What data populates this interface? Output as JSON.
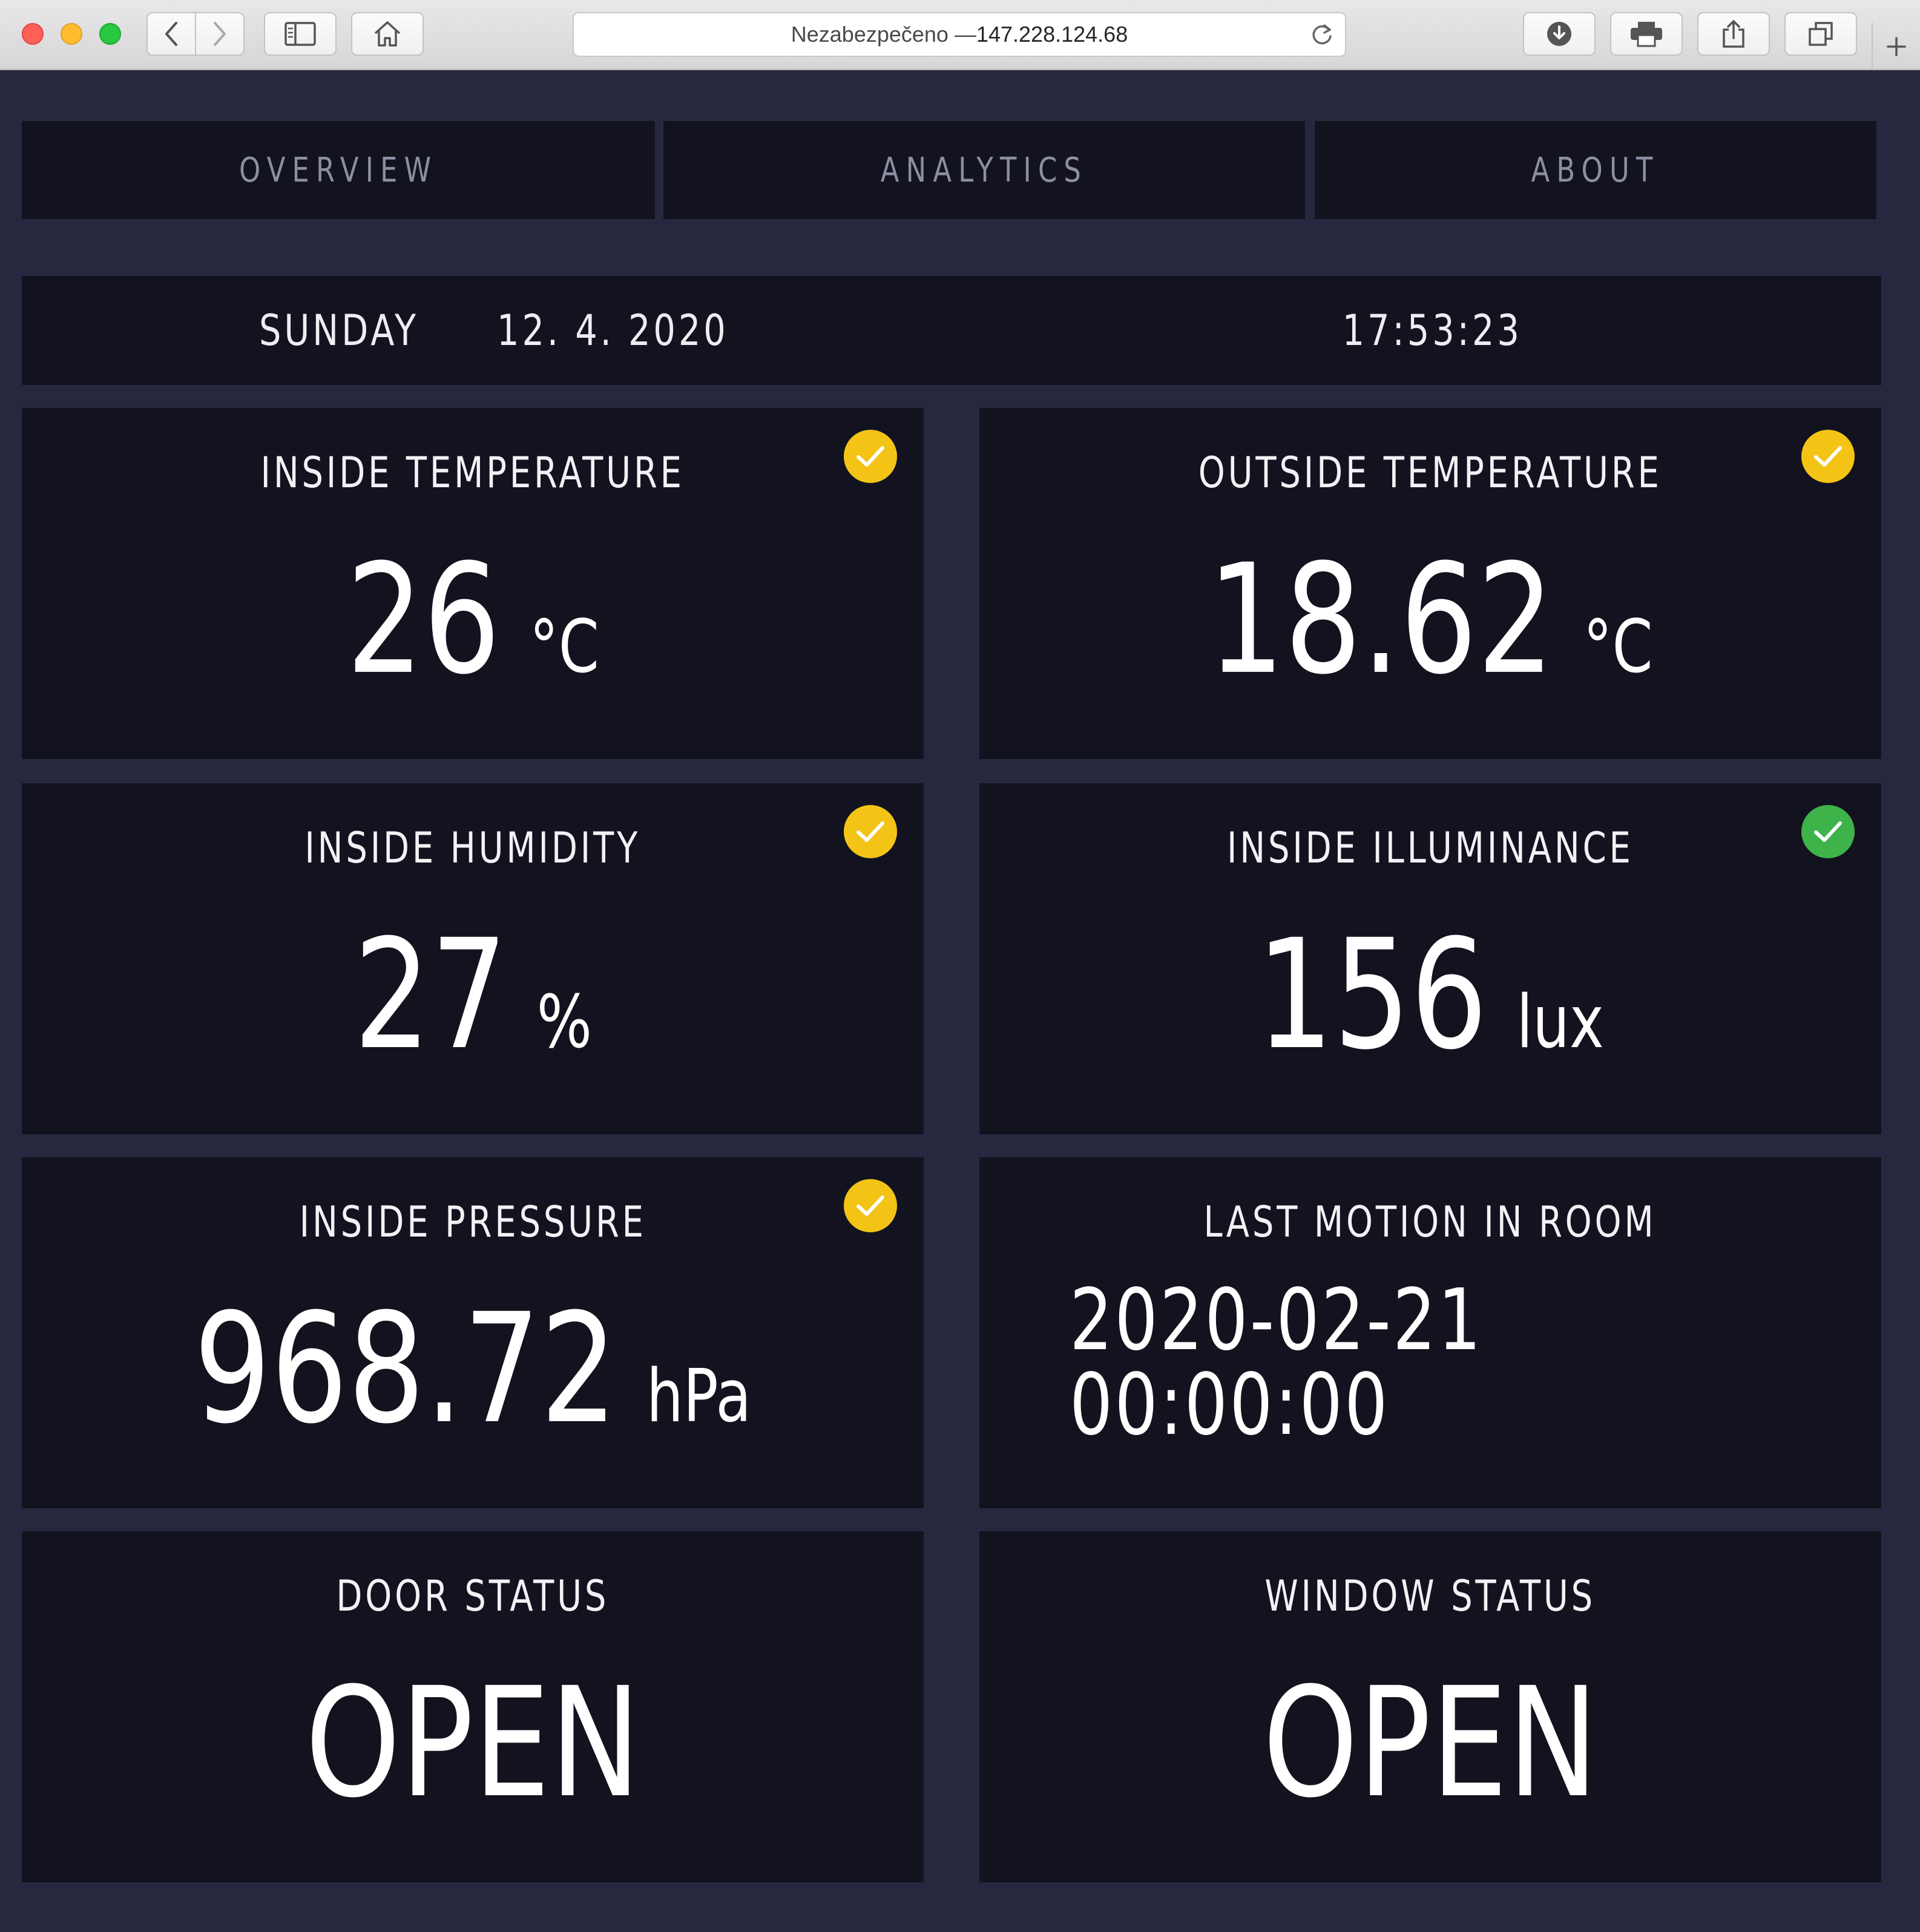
{
  "browser": {
    "address_prefix": "Nezabezpečeno — ",
    "address_host": "147.228.124.68",
    "icons": [
      "back-icon",
      "forward-icon",
      "sidebar-icon",
      "home-icon",
      "reload-icon",
      "download-icon",
      "print-icon",
      "share-icon",
      "tabs-icon",
      "plus-icon"
    ]
  },
  "nav": {
    "tabs": [
      {
        "label": "OVERVIEW"
      },
      {
        "label": "ANALYTICS"
      },
      {
        "label": "ABOUT"
      }
    ]
  },
  "datetime": {
    "day": "SUNDAY",
    "date": "12. 4. 2020",
    "time": "17:53:23"
  },
  "cards": {
    "inside_temp": {
      "title": "INSIDE TEMPERATURE",
      "value": "26",
      "unit": "°C",
      "status": "warning",
      "status_color": "#f3c316"
    },
    "outside_temp": {
      "title": "OUTSIDE TEMPERATURE",
      "value": "18.62",
      "unit": "°C",
      "status": "warning",
      "status_color": "#f3c316"
    },
    "humidity": {
      "title": "INSIDE HUMIDITY",
      "value": "27",
      "unit": "%",
      "status": "warning",
      "status_color": "#f3c316"
    },
    "illuminance": {
      "title": "INSIDE ILLUMINANCE",
      "value": "156",
      "unit": "lux",
      "status": "ok",
      "status_color": "#3db34a"
    },
    "pressure": {
      "title": "INSIDE PRESSURE",
      "value": "968.72",
      "unit": "hPa",
      "status": "warning",
      "status_color": "#f3c316"
    },
    "motion": {
      "title": "LAST MOTION IN ROOM",
      "value": "2020-02-21 00:00:00"
    },
    "door": {
      "title": "DOOR STATUS",
      "value": "OPEN"
    },
    "window": {
      "title": "WINDOW STATUS",
      "value": "OPEN"
    }
  },
  "colors": {
    "page_background": "#272840",
    "panel_background": "#13131f",
    "nav_text": "#8e8ea3",
    "warning": "#f3c316",
    "ok": "#3db34a"
  }
}
